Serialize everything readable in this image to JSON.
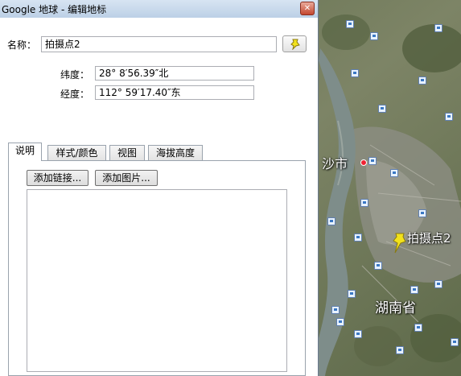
{
  "window": {
    "title": "Google 地球 - 编辑地标",
    "close_icon": "close-icon"
  },
  "placemark": {
    "name_label": "名称：",
    "name_value": "拍摄点2",
    "pin_icon": "yellow-pushpin-icon",
    "latitude_label": "纬度：",
    "latitude_value": "28° 8′56.39″北",
    "longitude_label": "经度：",
    "longitude_value": "112° 59′17.40″东"
  },
  "tabs": [
    {
      "label": "说明",
      "active": true
    },
    {
      "label": "样式/颜色",
      "active": false
    },
    {
      "label": "视图",
      "active": false
    },
    {
      "label": "海拔高度",
      "active": false
    }
  ],
  "description_panel": {
    "add_link_label": "添加链接...",
    "add_image_label": "添加图片...",
    "description_value": ""
  },
  "map": {
    "city_label": "长沙市",
    "city_label_visible": "沙市",
    "placemark_label": "拍摄点2",
    "province_label": "湖南省",
    "placemark_color": "#f2e21c"
  }
}
